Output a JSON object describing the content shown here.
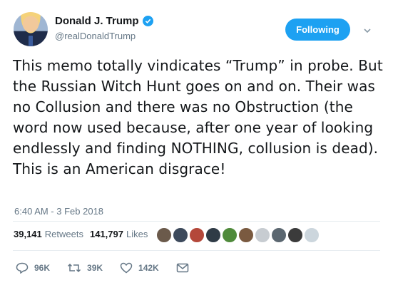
{
  "user": {
    "display_name": "Donald J. Trump",
    "handle": "@realDonaldTrump",
    "verified_icon": "verified-badge-icon"
  },
  "follow_button": {
    "label": "Following",
    "color": "#1da1f2"
  },
  "menu": {
    "icon": "chevron-down-icon"
  },
  "tweet": {
    "text": "This memo totally vindicates “Trump” in probe. But the Russian Witch Hunt goes on and on. Their was no Collusion and there was no Obstruction (the word now used because, after one year of looking endlessly and finding NOTHING, collusion is dead). This is an American disgrace!",
    "timestamp": "6:40 AM - 3 Feb 2018"
  },
  "stats": {
    "retweets_count": "39,141",
    "retweets_label": "Retweets",
    "likes_count": "141,797",
    "likes_label": "Likes"
  },
  "likers": [
    {
      "color": "#6b5a4b"
    },
    {
      "color": "#3d4a5c"
    },
    {
      "color": "#b4483a"
    },
    {
      "color": "#2f3b46"
    },
    {
      "color": "#4f8a3b"
    },
    {
      "color": "#7a5a40"
    },
    {
      "color": "#c7ccd1"
    },
    {
      "color": "#5b6770"
    },
    {
      "color": "#3b3b3b"
    },
    {
      "color": "#ccd6dd"
    }
  ],
  "actions": {
    "reply": {
      "icon": "reply-icon",
      "count": "96K"
    },
    "retweet": {
      "icon": "retweet-icon",
      "count": "39K"
    },
    "like": {
      "icon": "heart-icon",
      "count": "142K"
    },
    "message": {
      "icon": "envelope-icon"
    }
  },
  "colors": {
    "accent": "#1da1f2",
    "secondary_text": "#657786",
    "primary_text": "#14171a"
  }
}
